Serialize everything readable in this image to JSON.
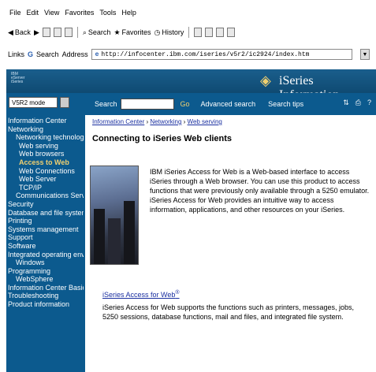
{
  "browser": {
    "menu": [
      "File",
      "Edit",
      "View",
      "Favorites",
      "Tools",
      "Help"
    ],
    "toolbar": {
      "back": "Back",
      "forward": "Forward",
      "search": "Search",
      "favorites": "Favorites",
      "history": "History"
    },
    "links_label": "Links",
    "search_label": "Search",
    "address_label": "Address",
    "address_url": "http://infocenter.ibm.com/iseries/v5r2/ic2924/index.htm"
  },
  "banner": {
    "ibm_text": "IBM eServer iSeries",
    "title": "iSeries Information Center"
  },
  "sidebar": {
    "view_value": "V5R2 mode",
    "items": [
      {
        "label": "Information Center",
        "level": 0
      },
      {
        "label": "Networking",
        "level": 0
      },
      {
        "label": "Networking technologies",
        "level": 1
      },
      {
        "label": "Web serving",
        "level": 2
      },
      {
        "label": "Web browsers",
        "level": 2
      },
      {
        "label": "Access to Web",
        "level": 2,
        "selected": true
      },
      {
        "label": "Web Connections",
        "level": 2
      },
      {
        "label": "Web Server",
        "level": 2
      },
      {
        "label": "TCP/IP",
        "level": 2
      },
      {
        "label": "Communications Server",
        "level": 1
      },
      {
        "label": "Security",
        "level": 0
      },
      {
        "label": "Database and file systems",
        "level": 0
      },
      {
        "label": "Printing",
        "level": 0
      },
      {
        "label": "Systems management",
        "level": 0
      },
      {
        "label": "Support",
        "level": 0
      },
      {
        "label": "Software",
        "level": 0
      },
      {
        "label": "Integrated operating environment",
        "level": 0
      },
      {
        "label": "Windows",
        "level": 1
      },
      {
        "label": "Programming",
        "level": 0
      },
      {
        "label": "WebSphere",
        "level": 1
      },
      {
        "label": "Information Center Basics",
        "level": 0
      },
      {
        "label": "Troubleshooting",
        "level": 0
      },
      {
        "label": "Product information",
        "level": 0
      }
    ]
  },
  "searchbar": {
    "search_label": "Search",
    "go": "Go",
    "advanced_search": "Advanced search",
    "search_tips": "Search tips"
  },
  "content": {
    "breadcrumb": [
      "Information Center",
      "Networking",
      "Web serving"
    ],
    "heading": "Connecting to iSeries Web clients",
    "intro": "IBM iSeries Access for Web is a Web-based interface to access iSeries through a Web browser. You can use this product to access functions that were previously only available through a 5250 emulator. iSeries Access for Web provides an intuitive way to access information, applications, and other resources on your iSeries.",
    "link_title": "iSeries Access for Web",
    "link_tm": "®",
    "link_description": "iSeries Access for Web supports the functions such as printers, messages, jobs, 5250 sessions, database functions, mail and files, and integrated file system."
  }
}
